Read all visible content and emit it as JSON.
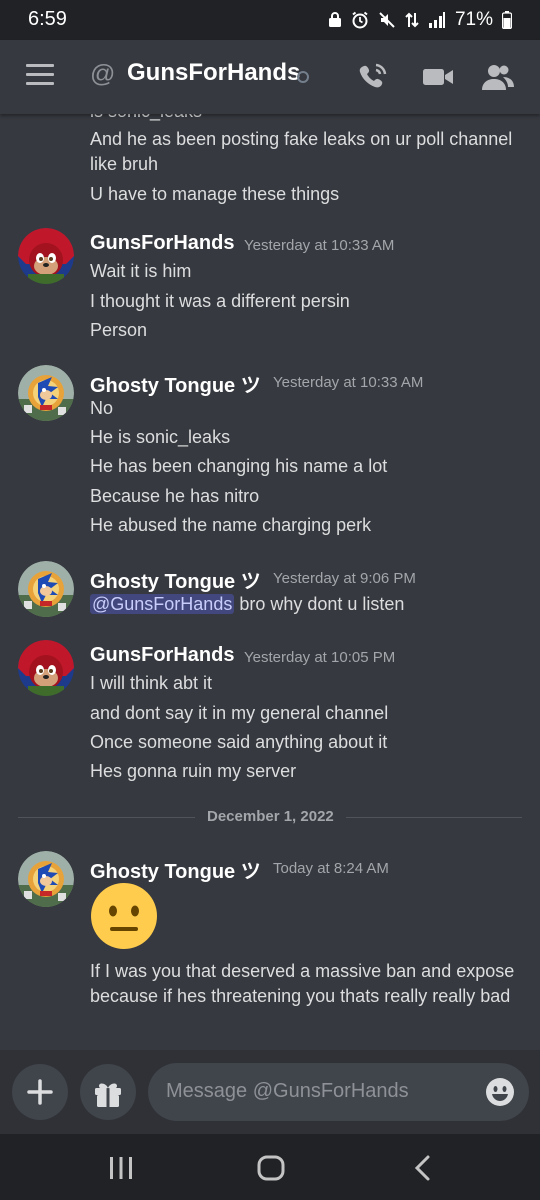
{
  "status_bar": {
    "time": "6:59",
    "battery": "71%"
  },
  "header": {
    "title": "GunsForHands"
  },
  "messages": {
    "partial_top": "is sonic_leaks",
    "g0_lines": [
      "And he as been posting fake leaks on ur poll channel",
      "like bruh",
      "U have to manage these things"
    ],
    "g1": {
      "author": "GunsForHands",
      "time": "Yesterday at 10:33 AM",
      "lines": [
        "Wait it is him",
        "I thought it was a different persin",
        "Person"
      ]
    },
    "g2": {
      "author": "Ghosty Tongue ツ",
      "time": "Yesterday at 10:33 AM",
      "lines": [
        "No",
        "He is sonic_leaks",
        "He has been changing his name a lot",
        "Because he has nitro",
        "He abused the name charging perk"
      ]
    },
    "g3": {
      "author": "Ghosty Tongue ツ",
      "time": "Yesterday at 9:06 PM",
      "mention": "@GunsForHands",
      "text": " bro why dont u listen"
    },
    "g4": {
      "author": "GunsForHands",
      "time": "Yesterday at 10:05 PM",
      "lines": [
        "I will think abt it",
        "and dont say it in my general channel",
        "Once someone said anything about it",
        "Hes gonna ruin my server"
      ]
    },
    "date_divider": "December 1, 2022",
    "g5": {
      "author": "Ghosty Tongue ツ",
      "time": "Today at 8:24 AM",
      "emoji": "neutral-face",
      "lines": [
        "If I was you that deserved a massive ban and expose",
        "because if hes threatening you thats really really bad"
      ]
    }
  },
  "composer": {
    "placeholder": "Message @GunsForHands"
  },
  "colors": {
    "background": "#36393f",
    "header": "#36393f",
    "system_bar": "#202225",
    "composer": "#2f3136",
    "input": "#40444b",
    "mention_bg": "#5865f2",
    "text": "#dcddde"
  }
}
